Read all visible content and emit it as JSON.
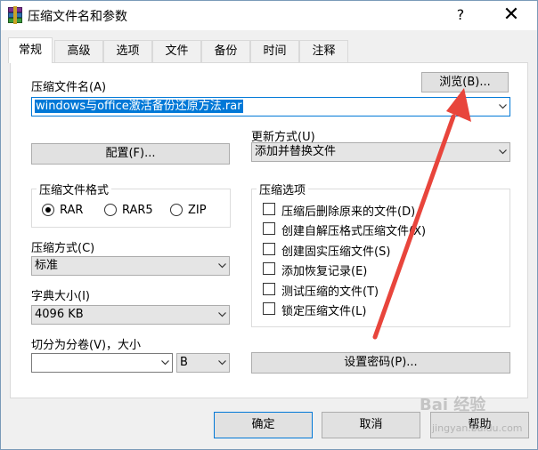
{
  "window": {
    "title": "压缩文件名和参数",
    "help": "?",
    "close": "✕"
  },
  "tabs": [
    {
      "label": "常规",
      "active": true
    },
    {
      "label": "高级"
    },
    {
      "label": "选项"
    },
    {
      "label": "文件"
    },
    {
      "label": "备份"
    },
    {
      "label": "时间"
    },
    {
      "label": "注释"
    }
  ],
  "archive": {
    "name_label": "压缩文件名(A)",
    "browse_button": "浏览(B)...",
    "name_value": "windows与office激活备份还原方法.rar"
  },
  "config_button": "配置(F)...",
  "update": {
    "label": "更新方式(U)",
    "value": "添加并替换文件"
  },
  "format": {
    "title": "压缩文件格式",
    "options": [
      {
        "label": "RAR",
        "selected": true
      },
      {
        "label": "RAR5",
        "selected": false
      },
      {
        "label": "ZIP",
        "selected": false
      }
    ]
  },
  "method": {
    "label": "压缩方式(C)",
    "value": "标准"
  },
  "dict": {
    "label": "字典大小(I)",
    "value": "4096 KB"
  },
  "split": {
    "label": "切分为分卷(V)，大小",
    "value": "",
    "unit": "B"
  },
  "options": {
    "title": "压缩选项",
    "items": [
      "压缩后删除原来的文件(D)",
      "创建自解压格式压缩文件(X)",
      "创建固实压缩文件(S)",
      "添加恢复记录(E)",
      "测试压缩的文件(T)",
      "锁定压缩文件(L)"
    ]
  },
  "password_button": "设置密码(P)...",
  "bottom": {
    "ok": "确定",
    "cancel": "取消",
    "help": "帮助"
  },
  "colors": {
    "annotation_arrow": "#e8453c",
    "selection": "#0078d7"
  },
  "watermark": {
    "text": "Bai 经验",
    "sub": "jingyan.baidu.com"
  }
}
